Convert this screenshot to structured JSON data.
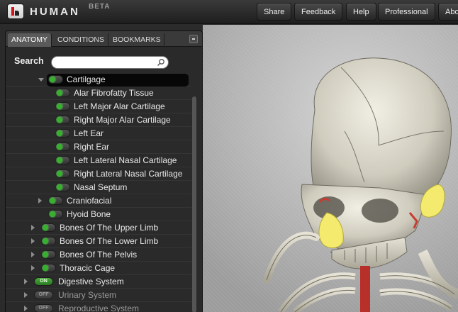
{
  "app": {
    "brand": "HUMAN",
    "badge": "BETA"
  },
  "nav": [
    {
      "label": "Share"
    },
    {
      "label": "Feedback"
    },
    {
      "label": "Help"
    },
    {
      "label": "Professional"
    },
    {
      "label": "Abo"
    }
  ],
  "tabs": [
    {
      "label": "ANATOMY",
      "active": true
    },
    {
      "label": "CONDITIONS",
      "active": false
    },
    {
      "label": "BOOKMARKS",
      "active": false
    }
  ],
  "search": {
    "label": "Search",
    "value": "",
    "placeholder": ""
  },
  "tree": [
    {
      "label": "Cartilgage",
      "level": 2,
      "expanded": true,
      "selected": true,
      "toggle": "dot",
      "visible": true
    },
    {
      "label": "Alar Fibrofatty Tissue",
      "level": 3,
      "toggle": "dot",
      "visible": true
    },
    {
      "label": "Left Major Alar Cartilage",
      "level": 3,
      "toggle": "dot",
      "visible": true
    },
    {
      "label": "Right Major Alar Cartilage",
      "level": 3,
      "toggle": "dot",
      "visible": true
    },
    {
      "label": "Left Ear",
      "level": 3,
      "toggle": "dot",
      "visible": true
    },
    {
      "label": "Right Ear",
      "level": 3,
      "toggle": "dot",
      "visible": true
    },
    {
      "label": "Left Lateral Nasal Cartilage",
      "level": 3,
      "toggle": "dot",
      "visible": true
    },
    {
      "label": "Right Lateral Nasal Cartilage",
      "level": 3,
      "toggle": "dot",
      "visible": true
    },
    {
      "label": "Nasal Septum",
      "level": 3,
      "toggle": "dot",
      "visible": true
    },
    {
      "label": "Craniofacial",
      "level": 2,
      "expanded": false,
      "toggle": "dot",
      "visible": true
    },
    {
      "label": "Hyoid Bone",
      "level": 2,
      "toggle": "dot",
      "visible": true
    },
    {
      "label": "Bones Of The Upper Limb",
      "level": 1,
      "expanded": false,
      "toggle": "dot",
      "visible": true
    },
    {
      "label": "Bones Of The Lower Limb",
      "level": 1,
      "expanded": false,
      "toggle": "dot",
      "visible": true
    },
    {
      "label": "Bones Of The Pelvis",
      "level": 1,
      "expanded": false,
      "toggle": "dot",
      "visible": true
    },
    {
      "label": "Thoracic Cage",
      "level": 1,
      "expanded": false,
      "toggle": "dot",
      "visible": true
    },
    {
      "label": "Digestive System",
      "level": 0,
      "expanded": false,
      "toggle": "on",
      "toggle_text": "ON",
      "visible": true
    },
    {
      "label": "Urinary System",
      "level": 0,
      "expanded": false,
      "toggle": "off",
      "toggle_text": "OFF",
      "visible": false
    },
    {
      "label": "Reproductive System",
      "level": 0,
      "expanded": false,
      "toggle": "off",
      "toggle_text": "OFF",
      "visible": false
    }
  ],
  "colors": {
    "toggle_on": "#37b02e",
    "highlight_cartilage": "#f3ea6e",
    "bone": "#d9d6c8",
    "muscle": "#b8302a"
  }
}
